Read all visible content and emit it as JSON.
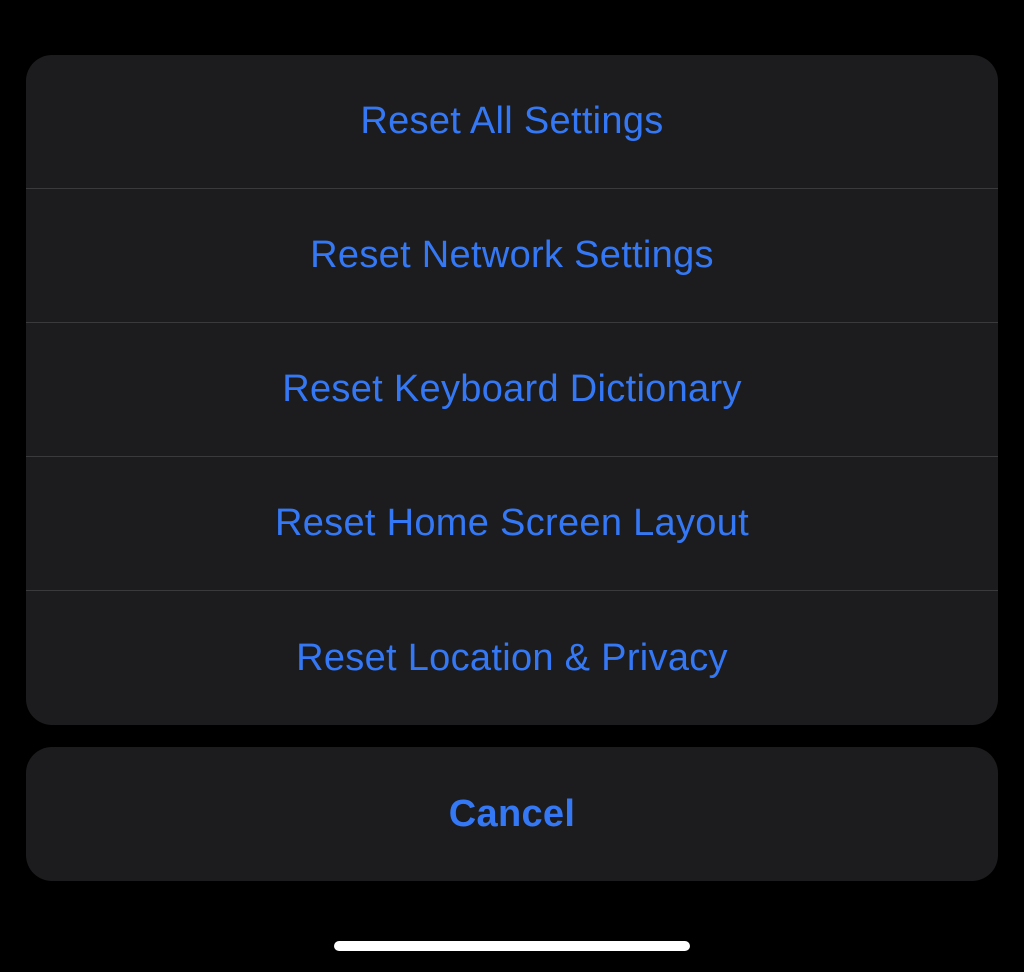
{
  "actionSheet": {
    "items": [
      {
        "label": "Reset All Settings"
      },
      {
        "label": "Reset Network Settings"
      },
      {
        "label": "Reset Keyboard Dictionary"
      },
      {
        "label": "Reset Home Screen Layout"
      },
      {
        "label": "Reset Location & Privacy"
      }
    ],
    "cancel": {
      "label": "Cancel"
    }
  }
}
